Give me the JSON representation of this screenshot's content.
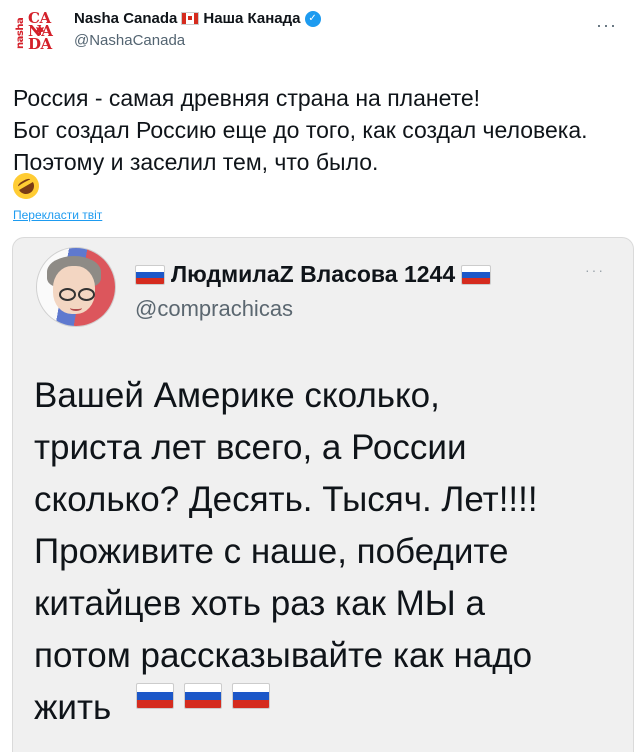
{
  "author": {
    "display_name": "Nasha Canada",
    "display_name_suffix": "Наша Канада",
    "handle": "@NashaCanada",
    "avatar_text_left": "nasha",
    "avatar_text_right": "CANADA",
    "verified_icon": "verified-badge-icon"
  },
  "tweet": {
    "text": "Россия - самая древняя страна на планете!\nБог создал Россию еще до того, как создал человека.\nПоэтому и заселил тем, что было.",
    "emoji": "rolling-on-floor-laughing",
    "translate_label": "Перекласти твіт"
  },
  "quoted": {
    "display_name": "ЛюдмилаZ Власова 1244",
    "handle": "@comprachicas",
    "text": "Вашей Америке сколько,\nтриста лет всего, а России\nсколько? Десять. Тысяч. Лет!!!!\nПроживите с наше, победите\nкитайцев хоть раз как МЫ а\nпотом рассказывайте как надо\nжить",
    "trailing_flags": [
      "russia-flag",
      "russia-flag",
      "russia-flag"
    ]
  },
  "colors": {
    "link": "#1d9bf0",
    "verified": "#1d9bf0",
    "brand_red": "#d4202a",
    "quote_bg": "#f0f0f0"
  }
}
